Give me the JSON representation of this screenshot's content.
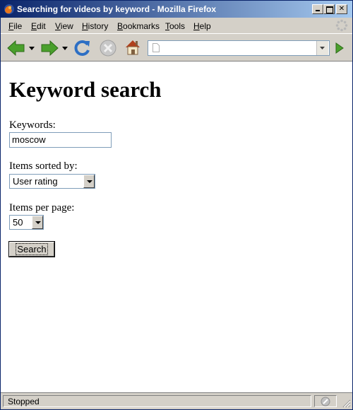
{
  "window": {
    "title": "Searching for videos by keyword - Mozilla Firefox",
    "controls": [
      "minimize-icon",
      "maximize-icon",
      "close-icon"
    ]
  },
  "menubar": {
    "items": [
      {
        "label": "File",
        "accel": "F",
        "rest": "ile"
      },
      {
        "label": "Edit",
        "accel": "E",
        "rest": "dit"
      },
      {
        "label": "View",
        "accel": "V",
        "rest": "iew"
      },
      {
        "label": "History",
        "accel": "H",
        "rest": "istory"
      },
      {
        "label": "Bookmarks",
        "accel": "B",
        "rest": "ookmarks"
      },
      {
        "label": "Tools",
        "accel": "T",
        "rest": "ools"
      },
      {
        "label": "Help",
        "accel": "H",
        "rest": "elp"
      }
    ]
  },
  "toolbar": {
    "icons": [
      "back-arrow-icon",
      "forward-arrow-icon",
      "reload-icon",
      "stop-icon",
      "home-icon",
      "go-icon"
    ],
    "url_value": ""
  },
  "page": {
    "heading": "Keyword search",
    "keywords_label": "Keywords:",
    "keywords_value": "moscow",
    "sort_label": "Items sorted by:",
    "sort_selected": "User rating",
    "per_page_label": "Items per page:",
    "per_page_selected": "50",
    "search_button": "Search"
  },
  "statusbar": {
    "text": "Stopped"
  },
  "colors": {
    "titlebar_start": "#0a246a",
    "titlebar_end": "#a6caf0",
    "chrome": "#d4d0c8",
    "nav_arrow_green": "#4aa02c",
    "reload_blue": "#2d6fc4"
  }
}
